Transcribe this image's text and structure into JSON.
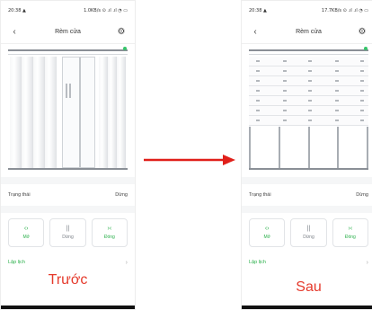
{
  "panels": [
    {
      "status_bar": {
        "time": "20:38 ▲",
        "signal": "1.0KB/s ⊙ .ıl .ıl ◔ ▭"
      },
      "title": "Rèm cửa",
      "state_label": "Trạng thái",
      "state_value": "Dừng",
      "buttons": {
        "open": "Mở",
        "stop": "Dừng",
        "close": "Đóng"
      },
      "schedule": "Lập lịch",
      "caption": "Trước"
    },
    {
      "status_bar": {
        "time": "20:38 ▲",
        "signal": "17.7KB/s ⊙ .ıl .ıl ◔ ▭"
      },
      "title": "Rèm cửa",
      "state_label": "Trạng thái",
      "state_value": "Dừng",
      "buttons": {
        "open": "Mở",
        "stop": "Dừng",
        "close": "Đóng"
      },
      "schedule": "Lập lịch",
      "caption": "Sau"
    }
  ],
  "colors": {
    "accent": "#2bb04b",
    "caption": "#e53a2c",
    "arrow": "#e0201a"
  },
  "icons": {
    "back": "chevron-left-icon",
    "settings": "gear-icon",
    "open": "expand-arrows-icon",
    "stop": "pause-icon",
    "close": "collapse-arrows-icon"
  }
}
